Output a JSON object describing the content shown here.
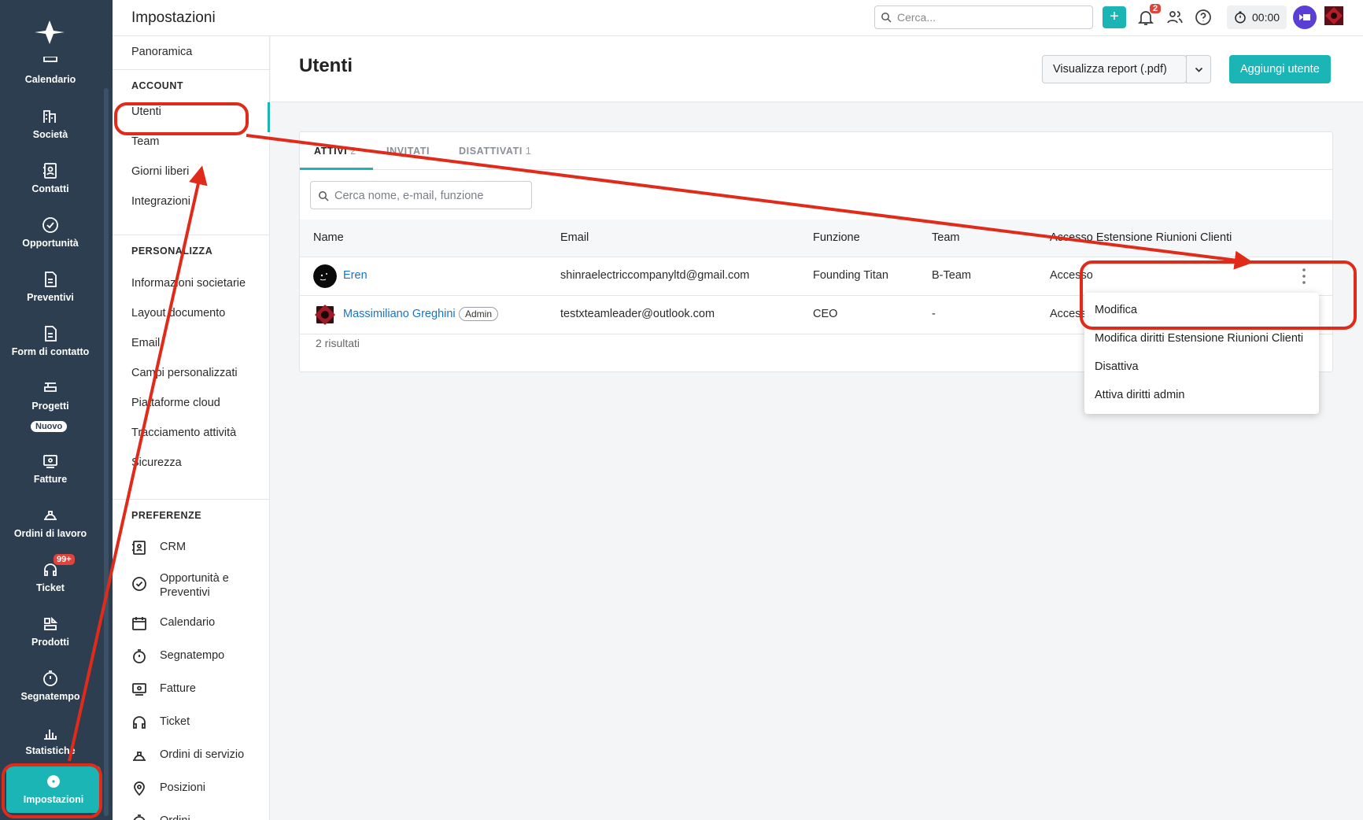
{
  "app_nav": {
    "items": [
      {
        "label": "Calendario",
        "icon": "calendar-icon"
      },
      {
        "label": "Società",
        "icon": "building-icon"
      },
      {
        "label": "Contatti",
        "icon": "contacts-icon"
      },
      {
        "label": "Opportunità",
        "icon": "check-circle-icon"
      },
      {
        "label": "Preventivi",
        "icon": "document-icon"
      },
      {
        "label": "Form di contatto",
        "icon": "form-icon"
      },
      {
        "label": "Progetti",
        "icon": "projects-icon",
        "badge": "Nuovo"
      },
      {
        "label": "Fatture",
        "icon": "invoice-icon"
      },
      {
        "label": "Ordini di lavoro",
        "icon": "helmet-icon"
      },
      {
        "label": "Ticket",
        "icon": "headset-icon",
        "badge": "99+"
      },
      {
        "label": "Prodotti",
        "icon": "products-icon"
      },
      {
        "label": "Segnatempo",
        "icon": "stopwatch-icon"
      },
      {
        "label": "Statistiche",
        "icon": "bar-chart-icon"
      },
      {
        "label": "Impostazioni",
        "icon": "gear-icon",
        "active": true
      }
    ]
  },
  "topbar": {
    "title": "Impostazioni",
    "search_placeholder": "Cerca...",
    "notification_count": "2",
    "timer": "00:00"
  },
  "subnav": {
    "overview": "Panoramica",
    "account_header": "ACCOUNT",
    "account_items": [
      "Utenti",
      "Team",
      "Giorni liberi",
      "Integrazioni"
    ],
    "personalizza_header": "PERSONALIZZA",
    "personalizza_items": [
      "Informazioni societarie",
      "Layout documento",
      "Email",
      "Campi personalizzati",
      "Piattaforme cloud",
      "Tracciamento attività",
      "Sicurezza"
    ],
    "preferenze_header": "PREFERENZE",
    "preferenze_items": [
      {
        "label": "CRM",
        "icon": "contacts-book-icon"
      },
      {
        "label": "Opportunità e Preventivi",
        "icon": "check-circle-icon"
      },
      {
        "label": "Calendario",
        "icon": "calendar-icon"
      },
      {
        "label": "Segnatempo",
        "icon": "stopwatch-icon"
      },
      {
        "label": "Fatture",
        "icon": "invoice-icon"
      },
      {
        "label": "Ticket",
        "icon": "headset-icon"
      },
      {
        "label": "Ordini di servizio",
        "icon": "helmet-icon"
      },
      {
        "label": "Posizioni",
        "icon": "location-pin-icon"
      },
      {
        "label": "Ordini",
        "icon": "stopwatch-icon"
      }
    ]
  },
  "main": {
    "title": "Utenti",
    "report_button": "Visualizza report (.pdf)",
    "add_button": "Aggiungi utente",
    "tabs": [
      {
        "label": "ATTIVI",
        "count": "2"
      },
      {
        "label": "INVITATI",
        "count": ""
      },
      {
        "label": "DISATTIVATI",
        "count": "1"
      }
    ],
    "search_placeholder": "Cerca nome, e-mail, funzione",
    "columns": [
      "Name",
      "Email",
      "Funzione",
      "Team",
      "Accesso Estensione Riunioni Clienti"
    ],
    "rows": [
      {
        "name": "Eren",
        "email": "shinraelectriccompanyltd@gmail.com",
        "role": "Founding Titan",
        "team": "B-Team",
        "access": "Accesso",
        "badge": ""
      },
      {
        "name": "Massimiliano Greghini",
        "email": "testxteamleader@outlook.com",
        "role": "CEO",
        "team": "-",
        "access": "Accesso",
        "badge": "Admin"
      }
    ],
    "results": "2 risultati"
  },
  "context_menu": {
    "items": [
      "Modifica",
      "Modifica diritti Estensione Riunioni Clienti",
      "Disattiva",
      "Attiva diritti admin"
    ]
  },
  "colors": {
    "sidebar": "#2c3e50",
    "accent": "#1bb5b5",
    "annotation": "#e02b1b",
    "link": "#1a73c8"
  }
}
